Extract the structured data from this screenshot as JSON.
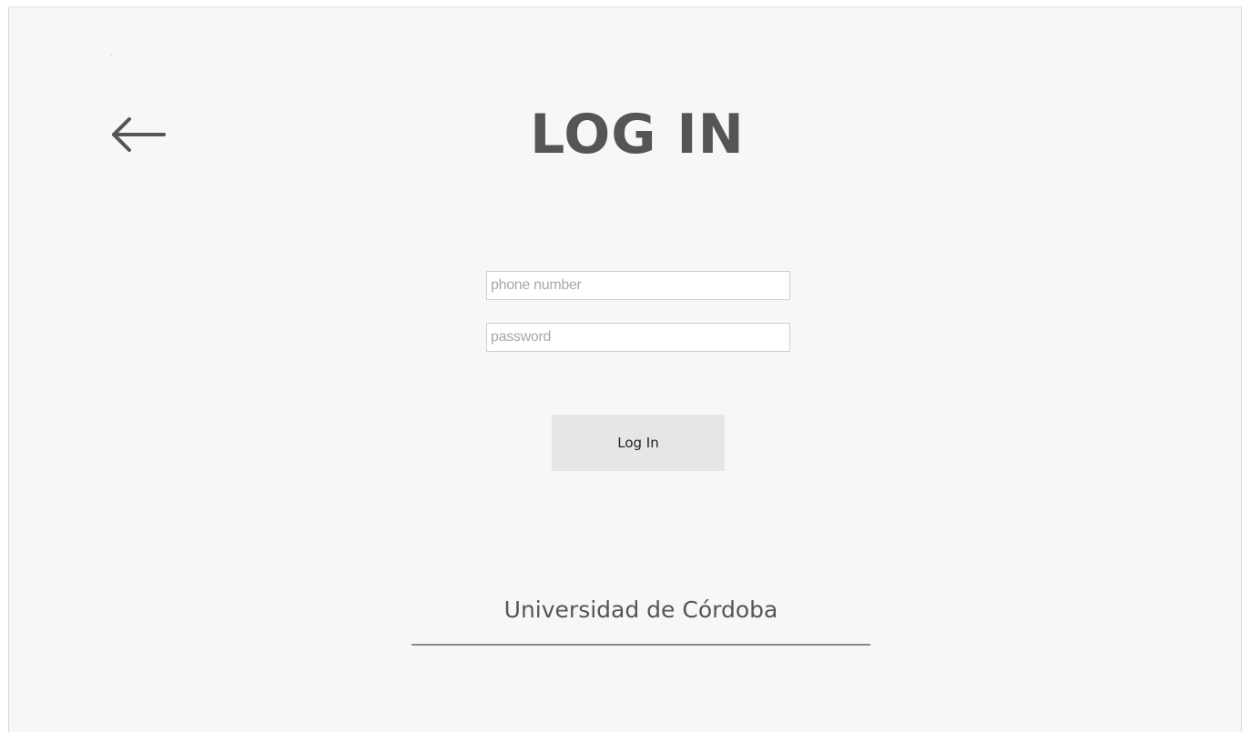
{
  "header": {
    "back_icon": "arrow-left-icon",
    "title": "LOG IN"
  },
  "form": {
    "phone": {
      "placeholder": "phone number",
      "value": ""
    },
    "password": {
      "placeholder": "password",
      "value": ""
    },
    "submit_label": "Log In"
  },
  "footer": {
    "institution": "Universidad de Córdoba"
  },
  "colors": {
    "background": "#f7f7f7",
    "text": "#555555",
    "button": "#e6e6e6",
    "divider": "#8a8a8a"
  }
}
